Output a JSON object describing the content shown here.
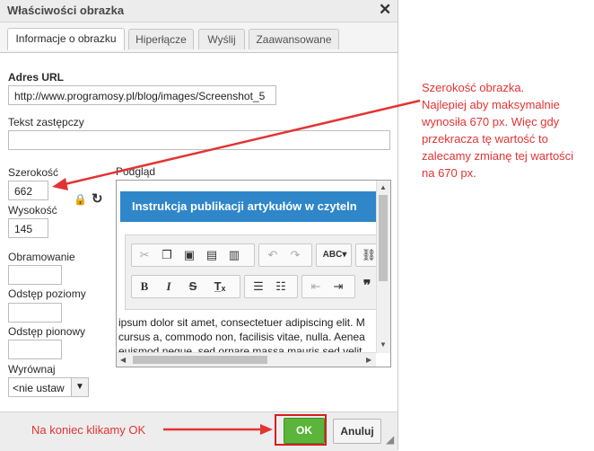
{
  "dialog": {
    "title": "Właściwości obrazka",
    "tabs": [
      "Informacje o obrazku",
      "Hiperłącze",
      "Wyślij",
      "Zaawansowane"
    ],
    "url_label": "Adres URL",
    "url_value": "http://www.programosy.pl/blog/images/Screenshot_5",
    "alt_label": "Tekst zastępczy",
    "alt_value": "",
    "width_label": "Szerokość",
    "width_value": "662",
    "height_label": "Wysokość",
    "height_value": "145",
    "border_label": "Obramowanie",
    "border_value": "",
    "hspace_label": "Odstęp poziomy",
    "hspace_value": "",
    "vspace_label": "Odstęp pionowy",
    "vspace_value": "",
    "align_label": "Wyrównaj",
    "align_value": "<nie ustaw",
    "preview_label": "Podgląd",
    "preview": {
      "header": "Instrukcja publikacji artykułów w czyteln",
      "line1": "ipsum dolor sit amet, consectetuer adipiscing elit. M",
      "line2": "cursus a, commodo non, facilisis vitae, nulla. Aenea",
      "line3": "euismod neque, sed ornare massa mauris sed velit"
    },
    "ok_label": "OK",
    "cancel_label": "Anuluj"
  },
  "annotations": {
    "right": [
      "Szerokość obrazka.",
      "Najlepiej aby maksymalnie",
      "wynosiła 670 px. Więc gdy",
      "przekracza tę wartość to",
      "zalecamy zmianę tej wartości",
      "na 670 px."
    ],
    "bottom": "Na koniec klikamy OK"
  },
  "colors": {
    "annotation": "#e33333",
    "ok_button": "#5bb53b",
    "preview_header": "#2f86c9"
  }
}
